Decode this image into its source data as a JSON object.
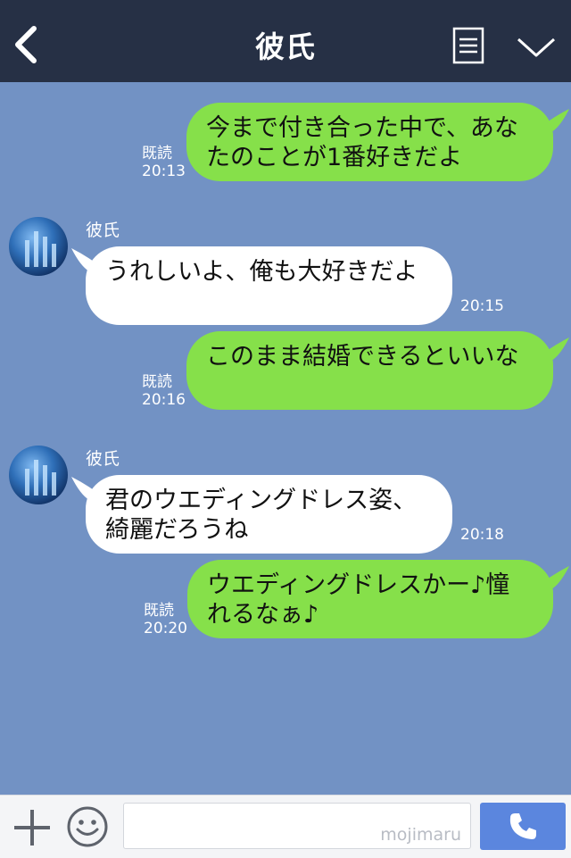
{
  "header": {
    "title": "彼氏"
  },
  "messages": [
    {
      "side": "me",
      "text": "今まで付き合った中で、あなたのことが1番好きだよ",
      "read": "既読",
      "time": "20:13"
    },
    {
      "side": "them",
      "sender": "彼氏",
      "text": "うれしいよ、俺も大好きだよ",
      "time": "20:15"
    },
    {
      "side": "me",
      "text": "このまま結婚できるといいな",
      "read": "既読",
      "time": "20:16"
    },
    {
      "side": "them",
      "sender": "彼氏",
      "text": "君のウエディングドレス姿、綺麗だろうね",
      "time": "20:18"
    },
    {
      "side": "me",
      "text": "ウエディングドレスかー♪憧れるなぁ♪",
      "read": "既読",
      "time": "20:20"
    }
  ],
  "footer": {
    "watermark": "mojimaru"
  },
  "colors": {
    "header_bg": "#263045",
    "chat_bg": "#7292c4",
    "my_bubble": "#86e04a",
    "their_bubble": "#ffffff",
    "call_button": "#5b86de"
  },
  "icons": [
    "back-chevron-icon",
    "menu-list-icon",
    "chevron-down-icon",
    "plus-icon",
    "smiley-icon",
    "phone-icon"
  ]
}
